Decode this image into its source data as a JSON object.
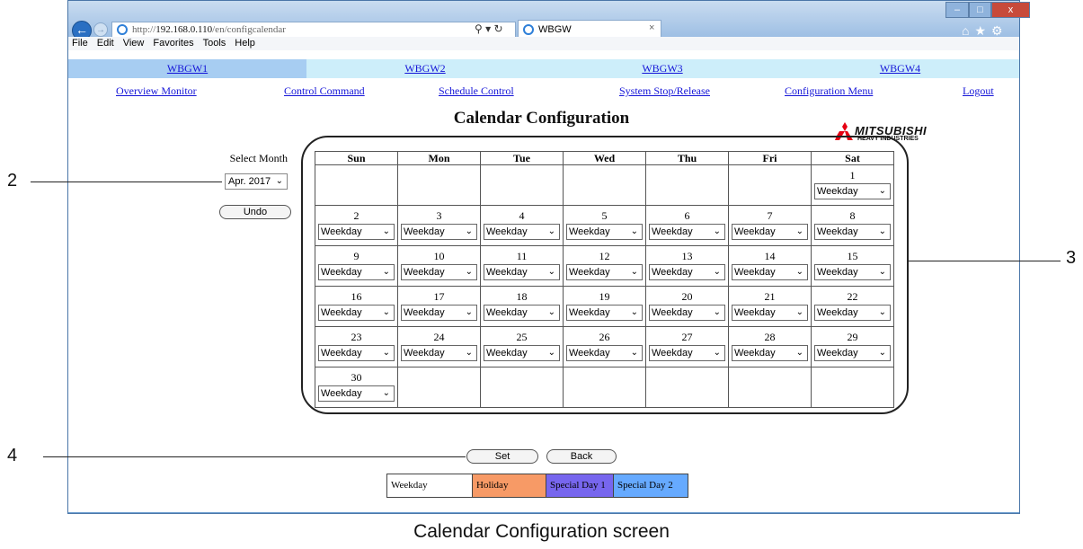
{
  "browser": {
    "url_prefix": "http://",
    "url_host": "192.168.0.110",
    "url_path": "/en/configcalendar",
    "tab_title": "WBGW",
    "tab_close": "×",
    "address_tools": "⚲ ▾ ↻",
    "window_buttons": [
      "–",
      "□",
      "x"
    ],
    "toolbar_icons": "⌂★⚙",
    "menu": [
      "File",
      "Edit",
      "View",
      "Favorites",
      "Tools",
      "Help"
    ]
  },
  "gateways": [
    "WBGW1",
    "WBGW2",
    "WBGW3",
    "WBGW4"
  ],
  "nav_links": [
    "Overview Monitor",
    "Control Command",
    "Schedule Control",
    "System Stop/Release",
    "Configuration Menu",
    "Logout"
  ],
  "page_title": "Calendar Configuration",
  "logo": {
    "line1": "MITSUBISHI",
    "line2": "HEAVY INDUSTRIES"
  },
  "select_month": {
    "label": "Select Month",
    "value": "Apr. 2017"
  },
  "undo_label": "Undo",
  "calendar": {
    "weekdays": [
      "Sun",
      "Mon",
      "Tue",
      "Wed",
      "Thu",
      "Fri",
      "Sat"
    ],
    "weeks": [
      [
        "",
        "",
        "",
        "",
        "",
        "",
        "1"
      ],
      [
        "2",
        "3",
        "4",
        "5",
        "6",
        "7",
        "8"
      ],
      [
        "9",
        "10",
        "11",
        "12",
        "13",
        "14",
        "15"
      ],
      [
        "16",
        "17",
        "18",
        "19",
        "20",
        "21",
        "22"
      ],
      [
        "23",
        "24",
        "25",
        "26",
        "27",
        "28",
        "29"
      ],
      [
        "30",
        "",
        "",
        "",
        "",
        "",
        ""
      ]
    ],
    "day_type_value": "Weekday"
  },
  "buttons": {
    "set": "Set",
    "back": "Back"
  },
  "legend": [
    {
      "label": "Weekday",
      "color": "#ffffff"
    },
    {
      "label": "Holiday",
      "color": "#f79a66"
    },
    {
      "label": "Special Day 1",
      "color": "#7766ee"
    },
    {
      "label": "Special Day 2",
      "color": "#66aaff"
    }
  ],
  "callouts": [
    "2",
    "3",
    "4"
  ],
  "caption": "Calendar Configuration screen",
  "colors": {
    "gateway_active": "#a7cdf2",
    "gateway_inactive": "#cdeefa",
    "link": "#1515d8",
    "logo_red": "#e60012"
  }
}
